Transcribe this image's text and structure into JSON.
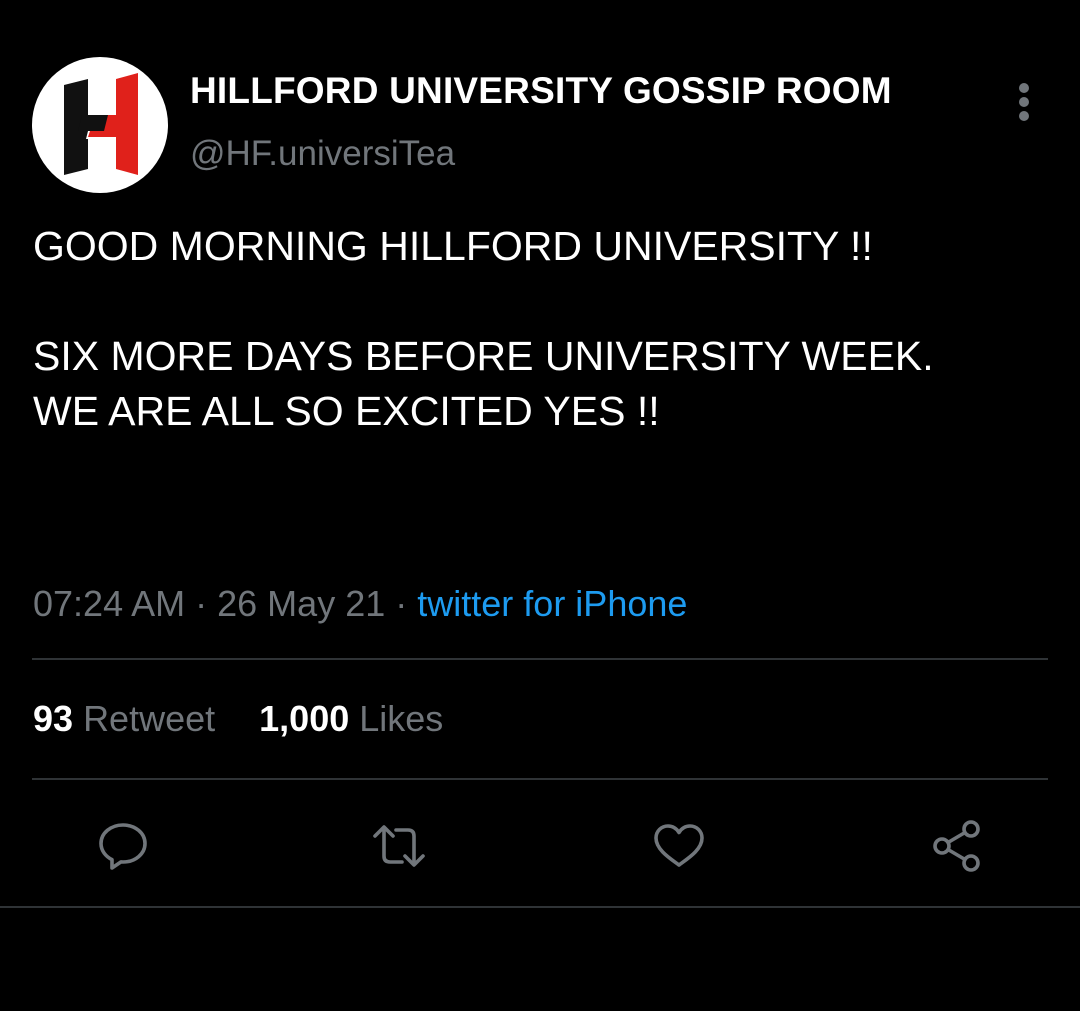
{
  "account": {
    "display_name": "HILLFORD UNIVERSITY GOSSIP ROOM",
    "handle": "@HF.universiTea"
  },
  "tweet": {
    "text": "GOOD MORNING HILLFORD UNIVERSITY !!\n\nSIX MORE DAYS BEFORE UNIVERSITY WEEK.\nWE ARE ALL SO EXCITED YES !!",
    "time": "07:24 AM",
    "date": "26 May 21",
    "separator": "·",
    "source": "twitter for iPhone"
  },
  "stats": {
    "retweets_count": "93",
    "retweets_label": "Retweet",
    "likes_count": "1,000",
    "likes_label": "Likes"
  },
  "icons": {
    "more": "more-vertical-icon",
    "reply": "reply-icon",
    "retweet": "retweet-icon",
    "like": "heart-icon",
    "share": "share-icon",
    "avatar_logo": "hillford-h-logo"
  },
  "colors": {
    "background": "#000000",
    "primary_text": "#ffffff",
    "secondary_text": "#71767b",
    "link": "#1d9bf0",
    "divider": "#2f3336",
    "logo_red": "#e0211b",
    "logo_black": "#111111"
  }
}
